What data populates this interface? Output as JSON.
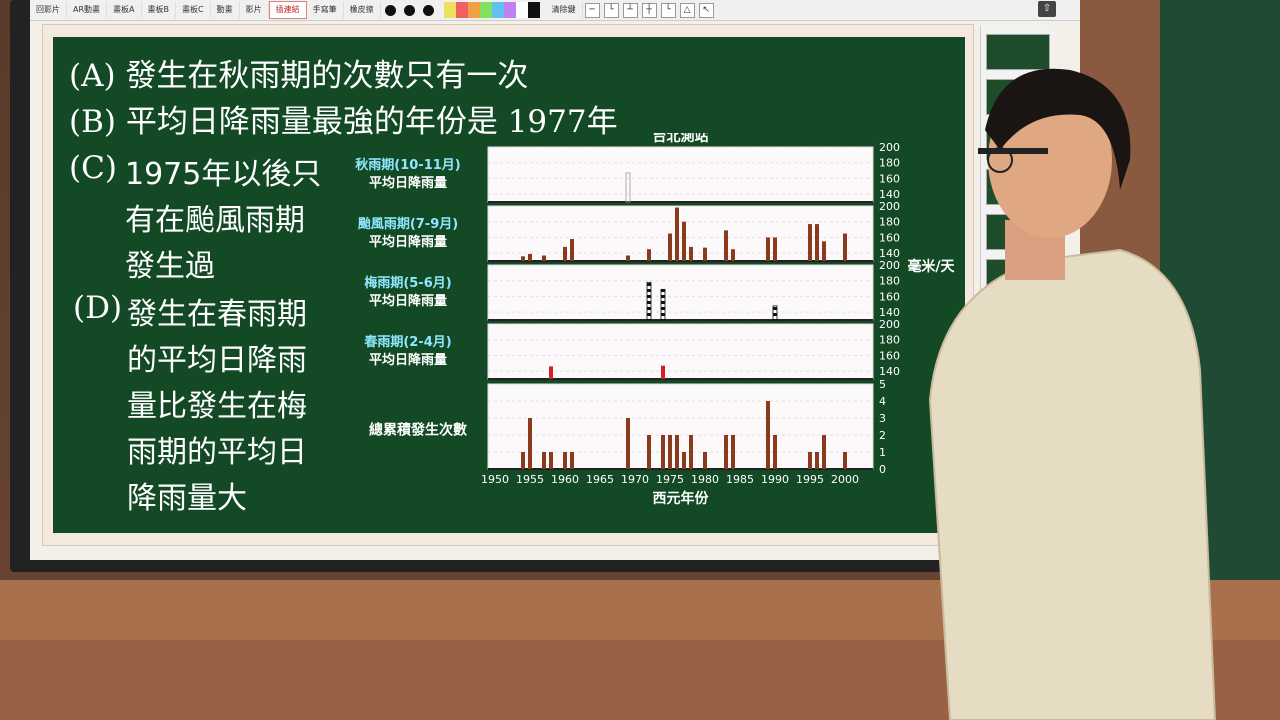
{
  "toolbar": {
    "items": [
      "回影片",
      "AR動畫",
      "畫板A",
      "畫板B",
      "畫板C",
      "動畫",
      "影片",
      "插連結",
      "手寫筆",
      "橡皮擦",
      "清除鍵"
    ],
    "active_index": 7
  },
  "slide": {
    "question": [
      {
        "label": "(A)",
        "text": "發生在秋雨期的次數只有一次"
      },
      {
        "label": "(B)",
        "text": "平均日降雨量最強的年份是 1977年"
      },
      {
        "label": "(C)",
        "lines": [
          "1975年以後只",
          "有在颱風雨期",
          "發生過"
        ]
      },
      {
        "label": "(D)",
        "lines": [
          "發生在春雨期",
          "的平均日降雨",
          "量比發生在梅",
          "雨期的平均日",
          "降雨量大"
        ]
      }
    ]
  },
  "chart_data": {
    "type": "bar",
    "title": "台北測站",
    "xlabel": "西元年份",
    "ylabel_right": "毫米/天",
    "x_ticks": [
      1950,
      1955,
      1960,
      1965,
      1970,
      1975,
      1980,
      1985,
      1990,
      1995,
      2000
    ],
    "panels": [
      {
        "name": "秋雨期(10-11月)",
        "sub": "平均日降雨量",
        "y_ticks": [
          200,
          180,
          160,
          140
        ],
        "ylim": [
          130,
          200
        ],
        "color": "outline",
        "bars": [
          {
            "x": 1969,
            "value": 167
          }
        ]
      },
      {
        "name": "颱風雨期(7-9月)",
        "sub": "平均日降雨量",
        "y_ticks": [
          200,
          180,
          160,
          140
        ],
        "ylim": [
          130,
          200
        ],
        "color": "#8b3a1e",
        "bars": [
          {
            "x": 1954,
            "value": 136
          },
          {
            "x": 1955,
            "value": 139
          },
          {
            "x": 1957,
            "value": 137
          },
          {
            "x": 1960,
            "value": 148
          },
          {
            "x": 1961,
            "value": 158
          },
          {
            "x": 1969,
            "value": 137
          },
          {
            "x": 1972,
            "value": 145
          },
          {
            "x": 1975,
            "value": 165
          },
          {
            "x": 1976,
            "value": 198
          },
          {
            "x": 1977,
            "value": 180
          },
          {
            "x": 1978,
            "value": 148
          },
          {
            "x": 1980,
            "value": 147
          },
          {
            "x": 1983,
            "value": 169
          },
          {
            "x": 1984,
            "value": 145
          },
          {
            "x": 1989,
            "value": 160
          },
          {
            "x": 1990,
            "value": 160
          },
          {
            "x": 1995,
            "value": 177
          },
          {
            "x": 1996,
            "value": 177
          },
          {
            "x": 1997,
            "value": 155
          },
          {
            "x": 2000,
            "value": 165
          }
        ]
      },
      {
        "name": "梅雨期(5-6月)",
        "sub": "平均日降雨量",
        "y_ticks": [
          200,
          180,
          160,
          140
        ],
        "ylim": [
          130,
          200
        ],
        "color": "checker",
        "bars": [
          {
            "x": 1972,
            "value": 178
          },
          {
            "x": 1974,
            "value": 169
          },
          {
            "x": 1990,
            "value": 148
          }
        ]
      },
      {
        "name": "春雨期(2-4月)",
        "sub": "平均日降雨量",
        "y_ticks": [
          200,
          180,
          160,
          140
        ],
        "ylim": [
          130,
          200
        ],
        "color": "#d62020",
        "bars": [
          {
            "x": 1958,
            "value": 146
          },
          {
            "x": 1974,
            "value": 147
          }
        ]
      },
      {
        "name": "總累積發生次數",
        "sub": "",
        "y_ticks": [
          5,
          4,
          3,
          2,
          1,
          0
        ],
        "ylim": [
          0,
          5
        ],
        "color": "#8b3a1e",
        "bars": [
          {
            "x": 1954,
            "value": 1
          },
          {
            "x": 1955,
            "value": 3
          },
          {
            "x": 1957,
            "value": 1
          },
          {
            "x": 1958,
            "value": 1
          },
          {
            "x": 1960,
            "value": 1
          },
          {
            "x": 1961,
            "value": 1
          },
          {
            "x": 1969,
            "value": 3
          },
          {
            "x": 1972,
            "value": 2
          },
          {
            "x": 1974,
            "value": 2
          },
          {
            "x": 1975,
            "value": 2
          },
          {
            "x": 1976,
            "value": 2
          },
          {
            "x": 1977,
            "value": 1
          },
          {
            "x": 1978,
            "value": 2
          },
          {
            "x": 1980,
            "value": 1
          },
          {
            "x": 1983,
            "value": 2
          },
          {
            "x": 1984,
            "value": 2
          },
          {
            "x": 1989,
            "value": 4
          },
          {
            "x": 1990,
            "value": 2
          },
          {
            "x": 1995,
            "value": 1
          },
          {
            "x": 1996,
            "value": 1
          },
          {
            "x": 1997,
            "value": 2
          },
          {
            "x": 2000,
            "value": 1
          }
        ]
      }
    ]
  }
}
